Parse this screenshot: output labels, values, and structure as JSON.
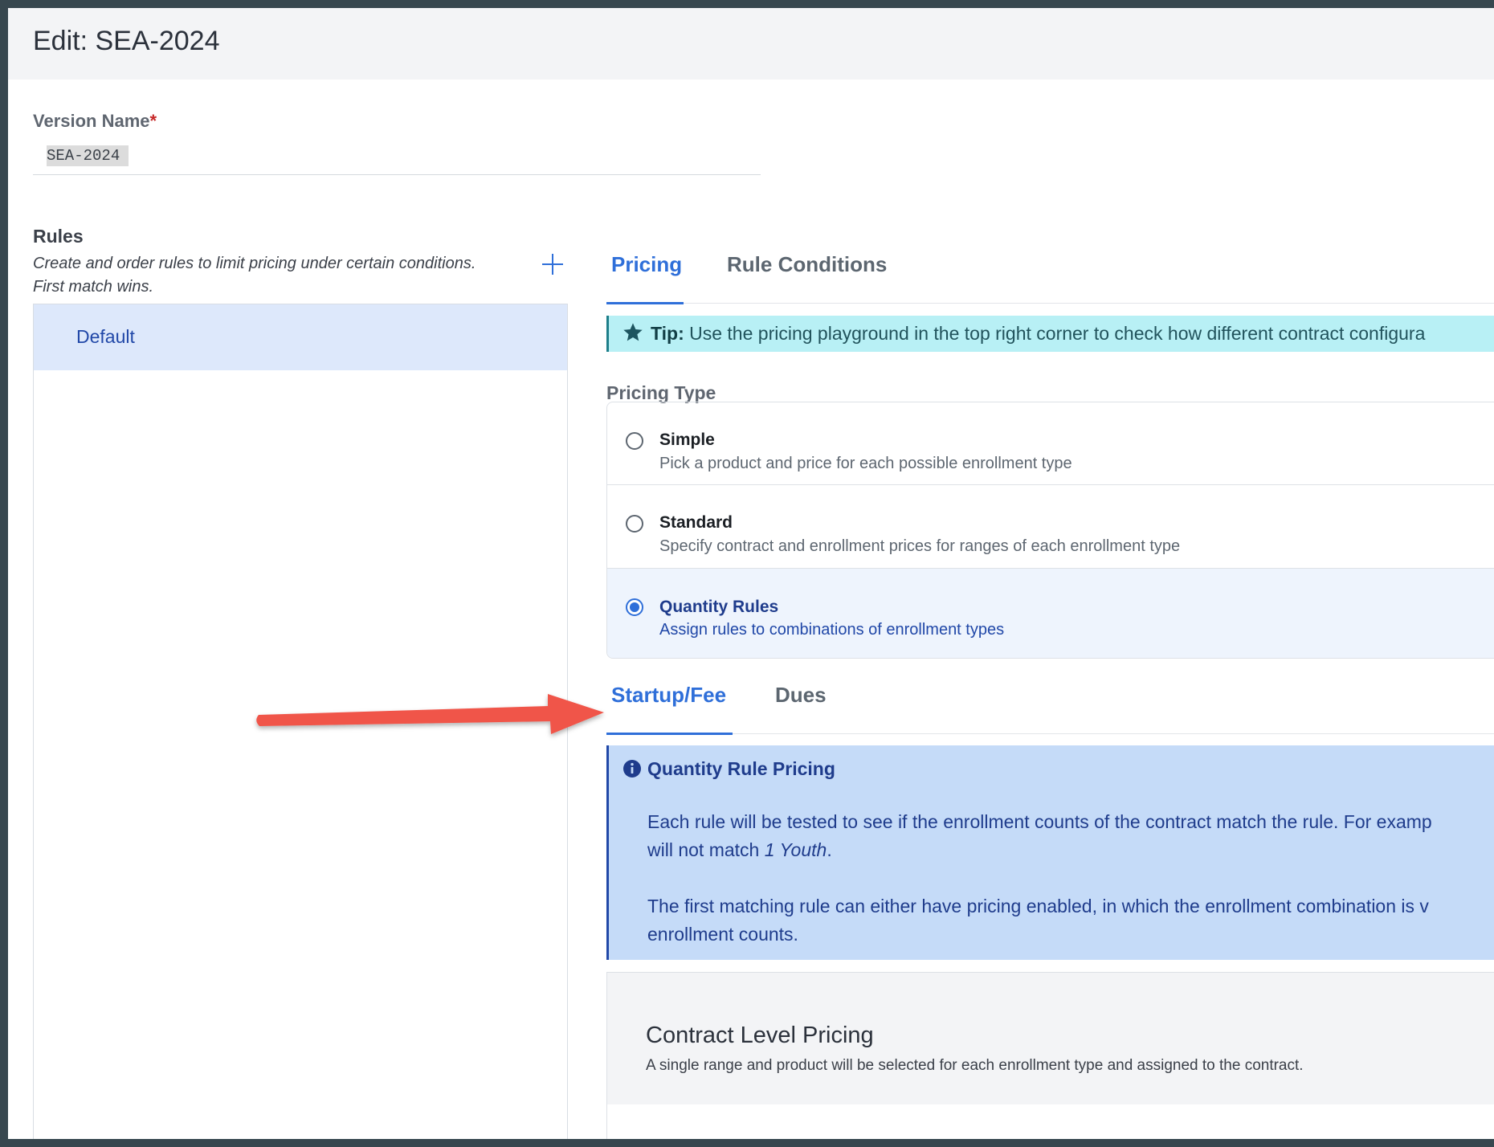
{
  "header": {
    "title": "Edit: SEA-2024"
  },
  "version": {
    "label": "Version Name",
    "required_mark": "*",
    "value": "SEA-2024"
  },
  "rules": {
    "title": "Rules",
    "description": "Create and order rules to limit pricing under certain conditions. First match wins.",
    "add_icon": "plus-icon",
    "items": [
      {
        "label": "Default"
      }
    ]
  },
  "tabs": [
    {
      "label": "Pricing",
      "active": true
    },
    {
      "label": "Rule Conditions",
      "active": false
    }
  ],
  "tip": {
    "icon": "star-icon",
    "prefix": "Tip:",
    "text": "Use the pricing playground in the top right corner to check how different contract configura"
  },
  "pricing_type": {
    "label": "Pricing Type",
    "options": [
      {
        "title": "Simple",
        "description": "Pick a product and price for each possible enrollment type",
        "selected": false
      },
      {
        "title": "Standard",
        "description": "Specify contract and enrollment prices for ranges of each enrollment type",
        "selected": false
      },
      {
        "title": "Quantity Rules",
        "description": "Assign rules to combinations of enrollment types",
        "selected": true
      }
    ]
  },
  "sub_tabs": [
    {
      "label": "Startup/Fee",
      "active": true
    },
    {
      "label": "Dues",
      "active": false
    }
  ],
  "info": {
    "icon": "info-circle-icon",
    "title": "Quantity Rule Pricing",
    "para1_a": "Each rule will be tested to see if the enrollment counts of the contract match the rule. For examp",
    "para1_b": "will not match ",
    "para1_em": "1 Youth",
    "para1_c": ".",
    "para2": "The first matching rule can either have pricing enabled, in which the enrollment combination is v enrollment counts."
  },
  "contract_pricing": {
    "title": "Contract Level Pricing",
    "description": "A single range and product will be selected for each enrollment type and assigned to the contract."
  },
  "colors": {
    "accent": "#2f6fd9",
    "tip_bg": "#b8f0f5",
    "info_bg": "#c5dbf8",
    "arrow": "#f0544a"
  }
}
